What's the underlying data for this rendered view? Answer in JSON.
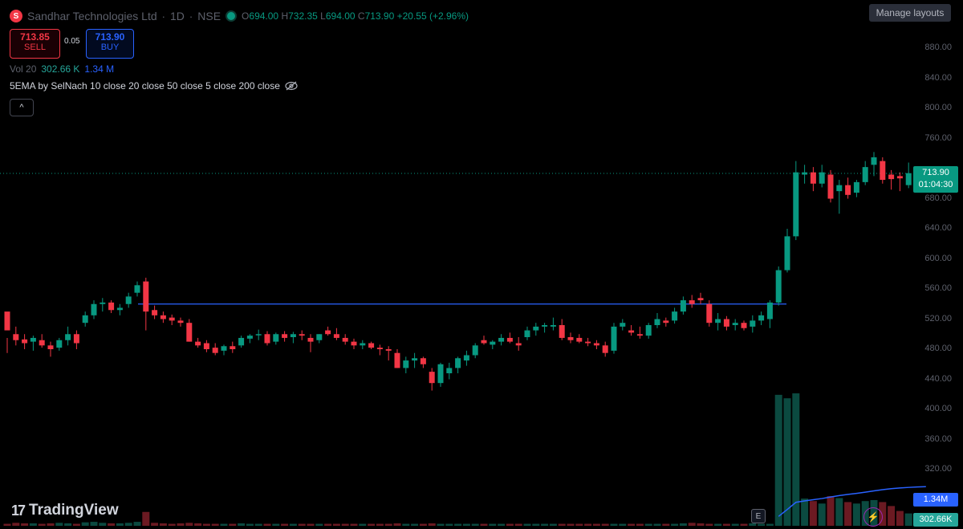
{
  "header": {
    "logo_letter": "S",
    "symbol_name": "Sandhar Technologies Ltd",
    "interval": "1D",
    "exchange": "NSE",
    "separator": "·",
    "ohlc": {
      "o_label": "O",
      "o": "694.00",
      "h_label": "H",
      "h": "732.35",
      "l_label": "L",
      "l": "694.00",
      "c_label": "C",
      "c": "713.90",
      "change": "+20.55 (+2.96%)"
    }
  },
  "trade": {
    "sell_price": "713.85",
    "sell_label": "SELL",
    "spread": "0.05",
    "buy_price": "713.90",
    "buy_label": "BUY"
  },
  "volume_legend": {
    "label": "Vol 20",
    "value": "302.66 K",
    "ma_value": "1.34 M"
  },
  "indicator_legend": {
    "text": "5EMA by SelNach 10 close 20 close 50 close 5 close 200 close",
    "visibility_icon": "eye-off-icon"
  },
  "collapse_button": {
    "icon": "chevron-up-icon",
    "glyph": "^"
  },
  "manage_layouts": "Manage layouts",
  "price_axis": [
    "880.00",
    "840.00",
    "800.00",
    "760.00",
    "680.00",
    "640.00",
    "600.00",
    "560.00",
    "520.00",
    "480.00",
    "440.00",
    "400.00",
    "360.00",
    "320.00"
  ],
  "current_price": {
    "price": "713.90",
    "countdown": "01:04:30"
  },
  "volume_tags": {
    "ma": "1.34M",
    "vol": "302.66K"
  },
  "branding": {
    "logo_glyph": "17",
    "name": "TradingView"
  },
  "earnings_marker": "E",
  "colors": {
    "up": "#089981",
    "down": "#f23645",
    "hline": "#2962ff",
    "vol_ma": "#2962ff",
    "background": "#000000"
  },
  "chart_data": {
    "type": "candlestick",
    "y_axis_ticks": [
      880,
      840,
      800,
      760,
      680,
      640,
      600,
      560,
      520,
      480,
      440,
      400,
      360,
      320
    ],
    "horizontal_line": 540,
    "candles": [
      [
        530,
        495,
        475,
        505
      ],
      [
        500,
        510,
        485,
        492
      ],
      [
        493,
        500,
        480,
        488
      ],
      [
        490,
        498,
        478,
        495
      ],
      [
        492,
        500,
        482,
        485
      ],
      [
        485,
        490,
        470,
        480
      ],
      [
        482,
        495,
        478,
        492
      ],
      [
        492,
        510,
        485,
        500
      ],
      [
        500,
        505,
        480,
        488
      ],
      [
        515,
        530,
        510,
        525
      ],
      [
        525,
        545,
        520,
        540
      ],
      [
        540,
        548,
        530,
        542
      ],
      [
        542,
        545,
        528,
        532
      ],
      [
        532,
        540,
        525,
        535
      ],
      [
        540,
        555,
        535,
        550
      ],
      [
        555,
        570,
        550,
        565
      ],
      [
        570,
        575,
        505,
        530
      ],
      [
        532,
        538,
        520,
        525
      ],
      [
        525,
        530,
        515,
        520
      ],
      [
        522,
        526,
        512,
        518
      ],
      [
        518,
        522,
        510,
        515
      ],
      [
        515,
        520,
        490,
        490
      ],
      [
        490,
        495,
        482,
        485
      ],
      [
        488,
        492,
        476,
        480
      ],
      [
        482,
        488,
        472,
        475
      ],
      [
        478,
        486,
        472,
        484
      ],
      [
        484,
        490,
        475,
        480
      ],
      [
        485,
        498,
        482,
        495
      ],
      [
        494,
        500,
        488,
        498
      ],
      [
        500,
        506,
        492,
        500
      ],
      [
        500,
        504,
        485,
        488
      ],
      [
        490,
        502,
        486,
        500
      ],
      [
        500,
        504,
        490,
        495
      ],
      [
        496,
        503,
        488,
        500
      ],
      [
        500,
        505,
        492,
        498
      ],
      [
        495,
        500,
        476,
        490
      ],
      [
        492,
        500,
        488,
        500
      ],
      [
        505,
        510,
        498,
        500
      ],
      [
        500,
        508,
        492,
        495
      ],
      [
        495,
        500,
        486,
        490
      ],
      [
        490,
        494,
        480,
        485
      ],
      [
        485,
        492,
        480,
        488
      ],
      [
        488,
        490,
        480,
        482
      ],
      [
        482,
        486,
        472,
        480
      ],
      [
        480,
        484,
        465,
        478
      ],
      [
        475,
        480,
        455,
        455
      ],
      [
        455,
        470,
        448,
        465
      ],
      [
        465,
        475,
        455,
        468
      ],
      [
        468,
        470,
        455,
        460
      ],
      [
        450,
        455,
        425,
        435
      ],
      [
        435,
        462,
        430,
        460
      ],
      [
        448,
        462,
        440,
        455
      ],
      [
        455,
        470,
        448,
        468
      ],
      [
        465,
        478,
        458,
        472
      ],
      [
        472,
        488,
        468,
        485
      ],
      [
        492,
        498,
        486,
        488
      ],
      [
        486,
        492,
        480,
        490
      ],
      [
        490,
        500,
        485,
        495
      ],
      [
        495,
        502,
        488,
        490
      ],
      [
        488,
        496,
        478,
        485
      ],
      [
        496,
        510,
        492,
        505
      ],
      [
        505,
        515,
        498,
        510
      ],
      [
        510,
        515,
        502,
        512
      ],
      [
        510,
        522,
        505,
        512
      ],
      [
        512,
        520,
        492,
        495
      ],
      [
        496,
        502,
        488,
        492
      ],
      [
        495,
        500,
        488,
        490
      ],
      [
        490,
        495,
        484,
        488
      ],
      [
        488,
        492,
        480,
        485
      ],
      [
        485,
        490,
        470,
        475
      ],
      [
        478,
        515,
        474,
        510
      ],
      [
        510,
        520,
        505,
        515
      ],
      [
        505,
        512,
        498,
        502
      ],
      [
        500,
        510,
        494,
        498
      ],
      [
        498,
        515,
        494,
        512
      ],
      [
        512,
        528,
        508,
        520
      ],
      [
        518,
        522,
        510,
        515
      ],
      [
        518,
        535,
        514,
        530
      ],
      [
        530,
        550,
        526,
        545
      ],
      [
        545,
        552,
        535,
        540
      ],
      [
        548,
        555,
        540,
        545
      ],
      [
        540,
        545,
        510,
        515
      ],
      [
        515,
        528,
        505,
        520
      ],
      [
        520,
        524,
        505,
        510
      ],
      [
        512,
        520,
        505,
        515
      ],
      [
        515,
        518,
        505,
        508
      ],
      [
        510,
        525,
        502,
        518
      ],
      [
        518,
        530,
        512,
        525
      ],
      [
        520,
        545,
        508,
        542
      ],
      [
        542,
        590,
        538,
        585
      ],
      [
        585,
        640,
        582,
        630
      ],
      [
        630,
        730,
        625,
        715
      ],
      [
        712,
        725,
        700,
        715
      ],
      [
        715,
        722,
        690,
        700
      ],
      [
        700,
        725,
        695,
        715
      ],
      [
        712,
        718,
        675,
        680
      ],
      [
        690,
        705,
        660,
        698
      ],
      [
        698,
        708,
        680,
        685
      ],
      [
        688,
        705,
        682,
        702
      ],
      [
        702,
        730,
        698,
        722
      ],
      [
        725,
        742,
        710,
        735
      ],
      [
        730,
        735,
        700,
        705
      ],
      [
        712,
        718,
        692,
        706
      ],
      [
        710,
        715,
        690,
        707
      ],
      [
        698,
        728,
        694,
        713.9
      ]
    ],
    "volumes": [
      4,
      6,
      5,
      5,
      4,
      5,
      6,
      5,
      4,
      7,
      8,
      6,
      5,
      5,
      6,
      8,
      28,
      6,
      5,
      4,
      5,
      6,
      5,
      4,
      4,
      4,
      4,
      5,
      4,
      4,
      4,
      4,
      4,
      4,
      4,
      4,
      4,
      4,
      4,
      4,
      4,
      4,
      4,
      4,
      4,
      5,
      4,
      4,
      4,
      5,
      4,
      4,
      4,
      4,
      4,
      4,
      4,
      4,
      4,
      4,
      4,
      4,
      4,
      4,
      4,
      4,
      4,
      4,
      4,
      4,
      4,
      4,
      4,
      4,
      4,
      4,
      4,
      4,
      5,
      6,
      5,
      4,
      4,
      4,
      4,
      4,
      5,
      4,
      4,
      265,
      258,
      268,
      55,
      50,
      45,
      60,
      56,
      48,
      45,
      50,
      52,
      48,
      40,
      30,
      25,
      20,
      18
    ]
  }
}
